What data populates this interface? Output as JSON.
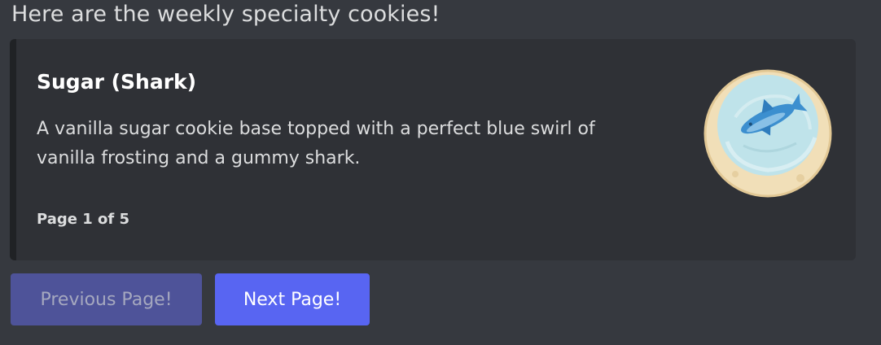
{
  "message": {
    "text": "Here are the weekly specialty cookies!"
  },
  "embed": {
    "title": "Sugar (Shark)",
    "description": "A vanilla sugar cookie base topped with a perfect blue swirl of vanilla frosting and a gummy shark.",
    "footer": "Page 1 of 5",
    "thumbnail": "sugar-shark-cookie-image"
  },
  "buttons": {
    "previous_label": "Previous Page!",
    "next_label": "Next Page!"
  },
  "colors": {
    "background": "#36393f",
    "embed_background": "#2f3136",
    "embed_border": "#202225",
    "button_primary": "#5865f2",
    "button_disabled": "#4e5399"
  }
}
